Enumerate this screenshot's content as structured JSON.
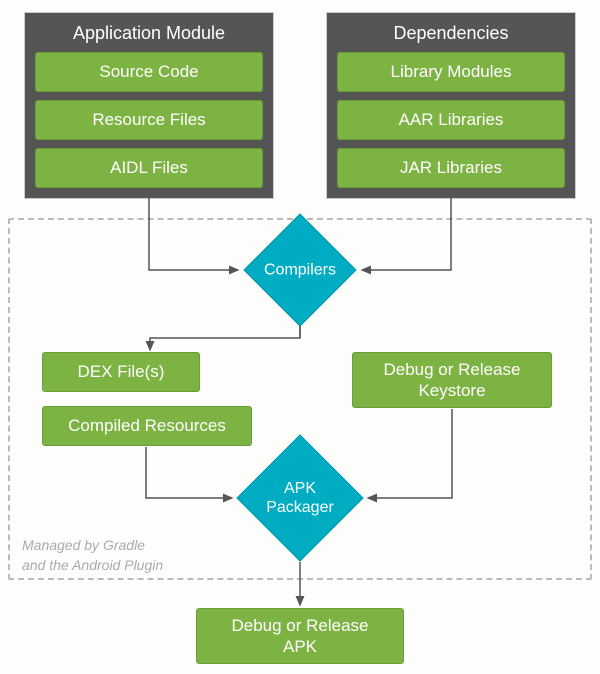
{
  "modules": {
    "app": {
      "title": "Application Module",
      "items": [
        "Source Code",
        "Resource Files",
        "AIDL Files"
      ]
    },
    "deps": {
      "title": "Dependencies",
      "items": [
        "Library Modules",
        "AAR Libraries",
        "JAR Libraries"
      ]
    }
  },
  "compilers": "Compilers",
  "dex": "DEX File(s)",
  "compiled_resources": "Compiled Resources",
  "keystore": "Debug or Release\nKeystore",
  "packager": "APK\nPackager",
  "output": "Debug or Release\nAPK",
  "managed_note": "Managed by Gradle\nand the Android Plugin",
  "colors": {
    "box_gray": "#555555",
    "green": "#7cb342",
    "teal": "#00acc1"
  }
}
